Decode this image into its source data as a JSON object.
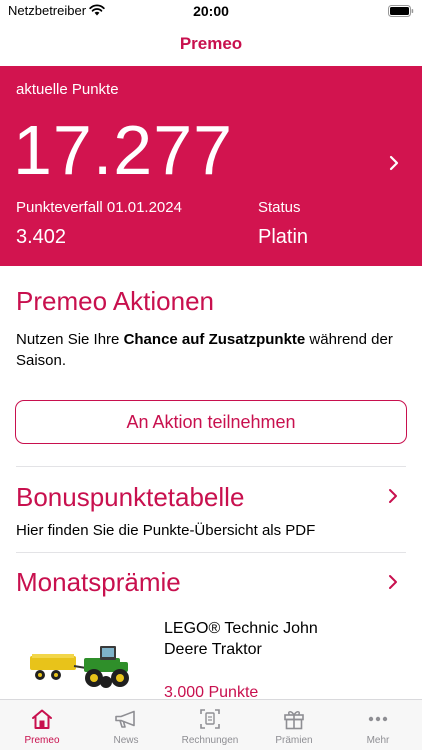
{
  "status_bar": {
    "carrier": "Netzbetreiber",
    "time": "20:00"
  },
  "nav": {
    "title": "Premeo"
  },
  "points": {
    "label": "aktuelle Punkte",
    "value": "17.277",
    "expiry_label": "Punkteverfall 01.01.2024",
    "expiry_value": "3.402",
    "status_label": "Status",
    "status_value": "Platin"
  },
  "aktionen": {
    "title": "Premeo Aktionen",
    "desc_prefix": "Nutzen Sie Ihre ",
    "desc_bold": "Chance auf Zusatzpunkte",
    "desc_suffix": " während der Saison.",
    "button_label": "An Aktion teilnehmen"
  },
  "bonus": {
    "title": "Bonuspunktetabelle",
    "subtitle": "Hier finden Sie die Punkte-Übersicht als PDF"
  },
  "monat": {
    "title": "Monatsprämie",
    "product_name": "LEGO® Technic John Deere Traktor",
    "product_points": "3.000 Punkte"
  },
  "tabs": [
    {
      "label": "Premeo",
      "icon": "home-icon",
      "active": true
    },
    {
      "label": "News",
      "icon": "megaphone-icon",
      "active": false
    },
    {
      "label": "Rechnungen",
      "icon": "receipt-icon",
      "active": false
    },
    {
      "label": "Prämien",
      "icon": "gift-icon",
      "active": false
    },
    {
      "label": "Mehr",
      "icon": "more-icon",
      "active": false
    }
  ],
  "colors": {
    "brand": "#d2144f",
    "accent_text": "#c8104e",
    "tab_inactive": "#8e8e93"
  }
}
